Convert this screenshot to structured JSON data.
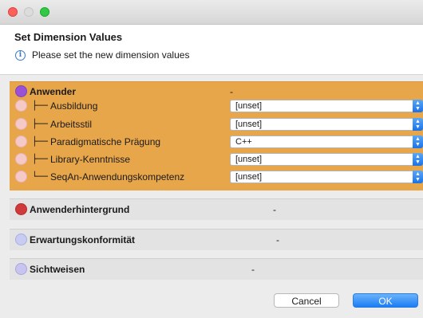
{
  "window": {
    "controls": [
      "close",
      "minimize",
      "zoom"
    ]
  },
  "header": {
    "title": "Set Dimension Values",
    "message": "Please set the new dimension values",
    "info_icon_glyph": "i"
  },
  "groups": [
    {
      "name": "Anwender",
      "value": "-",
      "color": "#9b51d6",
      "expanded": true,
      "children": [
        {
          "tree": "├──",
          "label": "Ausbildung",
          "value": "[unset]"
        },
        {
          "tree": "├──",
          "label": "Arbeitsstil",
          "value": "[unset]"
        },
        {
          "tree": "├──",
          "label": "Paradigmatische Prägung",
          "value": "C++"
        },
        {
          "tree": "├──",
          "label": "Library-Kenntnisse",
          "value": "[unset]"
        },
        {
          "tree": "└──",
          "label": "SeqAn-Anwendungskompetenz",
          "value": "[unset]"
        }
      ]
    },
    {
      "name": "Anwenderhintergrund",
      "value": "-",
      "color": "#d03a3a",
      "expanded": false
    },
    {
      "name": "Erwartungskonformität",
      "value": "-",
      "color": "#c8ccf2",
      "expanded": false
    },
    {
      "name": "Sichtweisen",
      "value": "-",
      "color": "#c8c4f0",
      "expanded": false
    }
  ],
  "child_dot_color": "#f6c9c9",
  "accent": "#e8a64a",
  "buttons": {
    "cancel": "Cancel",
    "ok": "OK"
  }
}
